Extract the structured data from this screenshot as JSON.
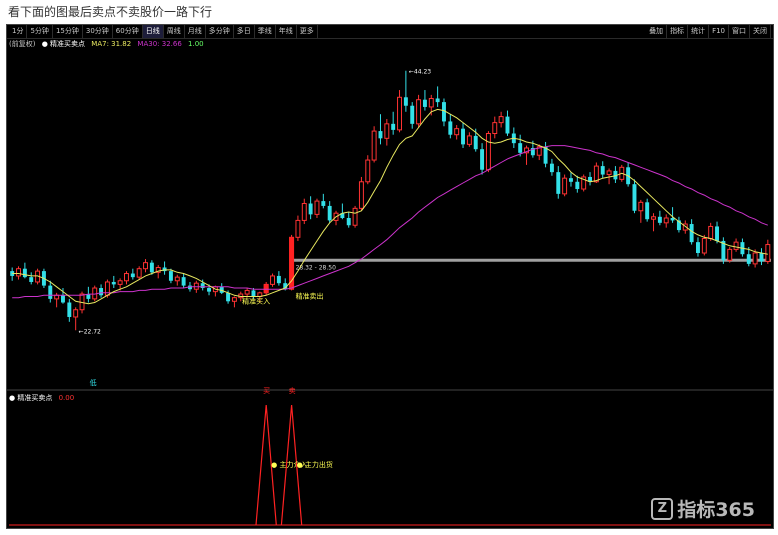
{
  "page": {
    "heading": "看下面的图最后卖点不卖股价一路下行"
  },
  "toolbar": {
    "left_items": [
      "1分",
      "5分钟",
      "15分钟",
      "30分钟",
      "60分钟",
      "日线",
      "周线",
      "月线",
      "多分钟",
      "多日",
      "季线",
      "年线",
      "更多"
    ],
    "active_index": 5,
    "right_items": [
      "叠加",
      "指标",
      "统计",
      "F10",
      "窗口",
      "关闭"
    ]
  },
  "legend_main": {
    "title": "(前复权)",
    "indicator": "● 精准买卖点",
    "ma_text": "MA7: 31.82",
    "ma2_text": "MA30: 32.66",
    "extra": "1.00"
  },
  "legend_sub": {
    "title": "● 精准买卖点",
    "value": "0.00"
  },
  "annotations": {
    "high_label": "44.23",
    "low_label": "22.72",
    "zone_label": "28.32 - 28.50",
    "buy_label": "精准买入",
    "sell_label": "精准卖出",
    "sub_label_a": "● 主力介入",
    "sub_label_b": "● 主力出货",
    "mark_buy": "买",
    "mark_sell": "卖",
    "mark_low": "低"
  },
  "colors": {
    "up": "#ff3333",
    "down": "#33e0e8",
    "ma_fast": "#e8e860",
    "ma_slow": "#cc33cc",
    "zone": "#a0a0a0",
    "signal": "#ff2222",
    "text_yellow": "#ffff55"
  },
  "chart_data": [
    {
      "type": "candlestick",
      "title": "",
      "xlabel": "",
      "ylabel": "",
      "ylim": [
        18,
        46
      ],
      "candles": [
        [
          27.6,
          27.9,
          26.8,
          27.2
        ],
        [
          27.2,
          28.0,
          26.9,
          27.8
        ],
        [
          27.8,
          28.3,
          27.0,
          27.1
        ],
        [
          27.1,
          27.5,
          26.5,
          26.7
        ],
        [
          26.7,
          27.8,
          26.5,
          27.6
        ],
        [
          27.6,
          27.8,
          26.2,
          26.4
        ],
        [
          26.4,
          26.8,
          25.0,
          25.3
        ],
        [
          25.3,
          25.8,
          24.6,
          25.6
        ],
        [
          25.6,
          26.2,
          24.9,
          25.0
        ],
        [
          25.0,
          25.3,
          23.4,
          23.8
        ],
        [
          23.8,
          24.6,
          22.7,
          24.4
        ],
        [
          24.4,
          25.9,
          24.1,
          25.7
        ],
        [
          25.7,
          26.3,
          25.0,
          25.3
        ],
        [
          25.3,
          26.4,
          25.1,
          26.2
        ],
        [
          26.2,
          26.5,
          25.4,
          25.6
        ],
        [
          25.6,
          26.9,
          25.4,
          26.7
        ],
        [
          26.7,
          27.2,
          26.2,
          26.5
        ],
        [
          26.5,
          27.0,
          26.0,
          26.8
        ],
        [
          26.8,
          27.6,
          26.5,
          27.4
        ],
        [
          27.4,
          27.8,
          26.9,
          27.1
        ],
        [
          27.1,
          28.0,
          26.9,
          27.8
        ],
        [
          27.8,
          28.6,
          27.5,
          28.3
        ],
        [
          28.3,
          28.5,
          27.3,
          27.5
        ],
        [
          27.5,
          28.1,
          27.0,
          27.9
        ],
        [
          27.9,
          28.4,
          27.3,
          27.6
        ],
        [
          27.6,
          27.8,
          26.6,
          26.8
        ],
        [
          26.8,
          27.3,
          26.4,
          27.1
        ],
        [
          27.1,
          27.4,
          26.2,
          26.4
        ],
        [
          26.4,
          26.7,
          25.9,
          26.1
        ],
        [
          26.1,
          26.8,
          25.8,
          26.6
        ],
        [
          26.6,
          26.9,
          26.0,
          26.2
        ],
        [
          26.2,
          26.5,
          25.6,
          25.9
        ],
        [
          25.9,
          26.4,
          25.5,
          26.3
        ],
        [
          26.3,
          26.6,
          25.7,
          25.8
        ],
        [
          25.8,
          26.0,
          24.9,
          25.1
        ],
        [
          25.1,
          25.5,
          24.6,
          25.4
        ],
        [
          25.4,
          25.9,
          25.1,
          25.7
        ],
        [
          25.7,
          26.2,
          25.4,
          26.0
        ],
        [
          26.0,
          26.2,
          25.3,
          25.5
        ],
        [
          25.5,
          25.9,
          25.0,
          25.8
        ],
        [
          25.8,
          26.7,
          25.6,
          26.5
        ],
        [
          26.5,
          27.4,
          26.3,
          27.2
        ],
        [
          27.2,
          27.6,
          26.4,
          26.6
        ],
        [
          26.6,
          27.0,
          26.0,
          26.1
        ],
        [
          26.1,
          30.6,
          26.0,
          30.4
        ],
        [
          30.4,
          32.2,
          30.1,
          31.8
        ],
        [
          31.8,
          33.6,
          31.5,
          33.2
        ],
        [
          33.2,
          33.8,
          31.9,
          32.3
        ],
        [
          32.3,
          33.6,
          32.0,
          33.4
        ],
        [
          33.4,
          34.0,
          32.8,
          33.0
        ],
        [
          33.0,
          33.4,
          31.6,
          31.8
        ],
        [
          31.8,
          32.6,
          31.4,
          32.4
        ],
        [
          32.4,
          33.2,
          31.9,
          32.0
        ],
        [
          32.0,
          32.5,
          31.2,
          31.4
        ],
        [
          31.4,
          33.0,
          31.2,
          32.8
        ],
        [
          32.8,
          35.4,
          32.6,
          35.0
        ],
        [
          35.0,
          37.2,
          34.8,
          36.8
        ],
        [
          36.8,
          39.6,
          36.6,
          39.2
        ],
        [
          39.2,
          40.6,
          38.1,
          38.6
        ],
        [
          38.6,
          40.2,
          38.0,
          39.8
        ],
        [
          39.8,
          40.8,
          38.9,
          39.3
        ],
        [
          39.3,
          42.6,
          39.1,
          42.0
        ],
        [
          42.0,
          44.2,
          40.8,
          41.3
        ],
        [
          41.3,
          41.6,
          39.4,
          39.8
        ],
        [
          39.8,
          42.2,
          39.5,
          41.8
        ],
        [
          41.8,
          42.6,
          40.9,
          41.2
        ],
        [
          41.2,
          42.2,
          40.5,
          41.9
        ],
        [
          41.9,
          42.9,
          41.2,
          41.6
        ],
        [
          41.6,
          41.9,
          39.6,
          40.0
        ],
        [
          40.0,
          40.6,
          38.6,
          38.9
        ],
        [
          38.9,
          39.7,
          38.5,
          39.4
        ],
        [
          39.4,
          39.9,
          37.8,
          38.1
        ],
        [
          38.1,
          39.1,
          37.9,
          38.8
        ],
        [
          38.8,
          39.4,
          37.5,
          37.7
        ],
        [
          37.7,
          38.2,
          35.6,
          36.0
        ],
        [
          36.0,
          39.2,
          35.8,
          39.0
        ],
        [
          39.0,
          40.4,
          38.6,
          39.9
        ],
        [
          39.9,
          40.8,
          39.5,
          40.4
        ],
        [
          40.4,
          40.9,
          38.8,
          39.0
        ],
        [
          39.0,
          39.5,
          37.8,
          38.2
        ],
        [
          38.2,
          38.9,
          37.1,
          37.4
        ],
        [
          37.4,
          38.0,
          36.4,
          37.8
        ],
        [
          37.8,
          38.4,
          37.0,
          37.2
        ],
        [
          37.2,
          38.1,
          36.8,
          37.9
        ],
        [
          37.9,
          38.3,
          36.2,
          36.5
        ],
        [
          36.5,
          36.9,
          35.5,
          35.8
        ],
        [
          35.8,
          36.3,
          33.6,
          34.0
        ],
        [
          34.0,
          35.6,
          33.8,
          35.3
        ],
        [
          35.3,
          35.8,
          34.6,
          35.0
        ],
        [
          35.0,
          35.5,
          34.1,
          34.4
        ],
        [
          34.4,
          35.6,
          34.2,
          35.4
        ],
        [
          35.4,
          35.8,
          34.7,
          35.0
        ],
        [
          35.0,
          36.6,
          34.9,
          36.3
        ],
        [
          36.3,
          36.7,
          35.3,
          35.6
        ],
        [
          35.6,
          36.1,
          34.8,
          35.9
        ],
        [
          35.9,
          36.3,
          34.9,
          35.2
        ],
        [
          35.2,
          36.4,
          35.0,
          36.2
        ],
        [
          36.2,
          36.6,
          34.6,
          34.8
        ],
        [
          34.8,
          35.2,
          32.4,
          32.6
        ],
        [
          32.6,
          33.5,
          31.6,
          33.3
        ],
        [
          33.3,
          33.6,
          31.7,
          31.9
        ],
        [
          31.9,
          32.4,
          30.9,
          32.1
        ],
        [
          32.1,
          32.6,
          31.4,
          31.6
        ],
        [
          31.6,
          32.3,
          31.2,
          32.0
        ],
        [
          32.0,
          32.9,
          31.6,
          31.8
        ],
        [
          31.8,
          32.1,
          30.8,
          31.0
        ],
        [
          31.0,
          31.8,
          30.7,
          31.5
        ],
        [
          31.5,
          31.9,
          29.8,
          30.0
        ],
        [
          30.0,
          30.4,
          28.8,
          29.1
        ],
        [
          29.1,
          30.6,
          28.9,
          30.3
        ],
        [
          30.3,
          31.6,
          30.1,
          31.3
        ],
        [
          31.3,
          31.7,
          29.9,
          30.1
        ],
        [
          30.1,
          30.4,
          28.2,
          28.5
        ],
        [
          28.5,
          29.6,
          28.3,
          29.4
        ],
        [
          29.4,
          30.3,
          29.2,
          30.0
        ],
        [
          30.0,
          30.3,
          28.8,
          29.0
        ],
        [
          29.0,
          29.6,
          28.0,
          28.2
        ],
        [
          28.2,
          29.4,
          27.9,
          29.1
        ],
        [
          29.1,
          29.5,
          28.1,
          28.4
        ],
        [
          28.4,
          30.2,
          28.2,
          29.8
        ]
      ],
      "ma7": [
        27.4,
        27.4,
        27.3,
        27.2,
        27.2,
        27.0,
        26.7,
        26.3,
        25.9,
        25.5,
        25.1,
        25.0,
        24.9,
        25.0,
        25.3,
        25.6,
        25.9,
        26.1,
        26.3,
        26.6,
        26.9,
        27.2,
        27.4,
        27.6,
        27.7,
        27.7,
        27.5,
        27.4,
        27.2,
        27.0,
        26.7,
        26.4,
        26.1,
        26.0,
        25.8,
        25.6,
        25.5,
        25.5,
        25.5,
        25.5,
        25.6,
        25.8,
        26.0,
        26.2,
        26.8,
        27.6,
        28.5,
        29.3,
        30.1,
        30.9,
        31.6,
        32.1,
        32.4,
        32.5,
        32.4,
        32.6,
        33.3,
        34.2,
        35.1,
        36.2,
        37.2,
        38.1,
        38.6,
        38.8,
        39.5,
        40.2,
        40.8,
        41.0,
        40.9,
        40.6,
        40.3,
        39.9,
        39.5,
        39.1,
        38.6,
        38.3,
        38.2,
        38.3,
        38.5,
        38.6,
        38.5,
        38.3,
        38.2,
        38.0,
        37.8,
        37.5,
        36.9,
        36.4,
        35.8,
        35.4,
        35.2,
        35.0,
        35.1,
        35.3,
        35.4,
        35.5,
        35.7,
        35.5,
        35.1,
        34.6,
        34.1,
        33.6,
        33.1,
        32.6,
        32.1,
        31.7,
        31.3,
        30.9,
        30.6,
        30.4,
        30.3,
        30.1,
        29.9,
        29.7,
        29.6,
        29.5,
        29.4,
        29.2,
        29.1,
        29.0
      ],
      "ma30": [
        25.4,
        25.4,
        25.5,
        25.5,
        25.5,
        25.6,
        25.6,
        25.6,
        25.6,
        25.6,
        25.6,
        25.6,
        25.7,
        25.7,
        25.8,
        25.8,
        25.8,
        25.9,
        25.9,
        25.9,
        26.0,
        26.0,
        26.1,
        26.1,
        26.1,
        26.2,
        26.2,
        26.2,
        26.3,
        26.3,
        26.3,
        26.3,
        26.3,
        26.3,
        26.3,
        26.2,
        26.2,
        26.2,
        26.1,
        26.1,
        26.1,
        26.1,
        26.1,
        26.1,
        26.2,
        26.4,
        26.6,
        26.8,
        27.0,
        27.2,
        27.4,
        27.6,
        27.8,
        28.0,
        28.3,
        28.6,
        29.0,
        29.4,
        29.8,
        30.2,
        30.7,
        31.2,
        31.6,
        32.0,
        32.5,
        32.9,
        33.3,
        33.7,
        34.0,
        34.3,
        34.6,
        34.9,
        35.2,
        35.5,
        35.7,
        36.0,
        36.3,
        36.6,
        36.9,
        37.1,
        37.3,
        37.5,
        37.7,
        37.8,
        37.9,
        38.0,
        38.0,
        38.0,
        37.9,
        37.8,
        37.7,
        37.6,
        37.4,
        37.3,
        37.1,
        37.0,
        36.8,
        36.6,
        36.4,
        36.2,
        36.0,
        35.8,
        35.6,
        35.4,
        35.1,
        34.9,
        34.6,
        34.4,
        34.1,
        33.9,
        33.6,
        33.4,
        33.1,
        32.9,
        32.6,
        32.4,
        32.1,
        31.9,
        31.6,
        31.4
      ],
      "support_zone": [
        28.32,
        28.5
      ],
      "signals": [
        {
          "index": 40,
          "type": "buy"
        },
        {
          "index": 44,
          "type": "sell"
        }
      ]
    },
    {
      "type": "line",
      "title": "",
      "ylim": [
        0,
        1
      ],
      "x_count": 120,
      "spikes": [
        {
          "index": 40,
          "value": 1.0
        },
        {
          "index": 44,
          "value": 1.0
        }
      ]
    }
  ]
}
